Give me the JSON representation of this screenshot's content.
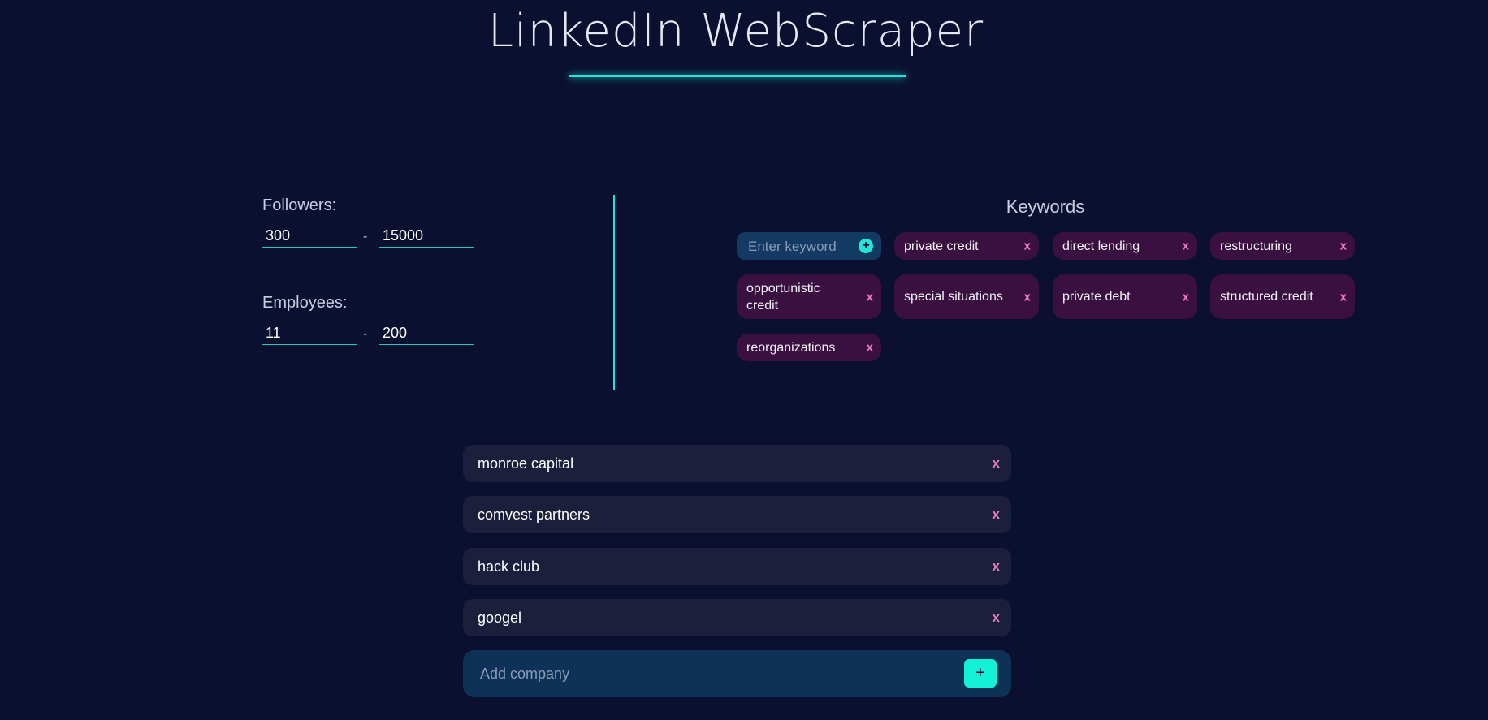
{
  "header": {
    "title": "LinkedIn WebScraper"
  },
  "filters": {
    "followers": {
      "label": "Followers:",
      "min": "300",
      "max": "15000",
      "separator": "-"
    },
    "employees": {
      "label": "Employees:",
      "min": "11",
      "max": "200",
      "separator": "-"
    }
  },
  "keywords": {
    "title": "Keywords",
    "input_placeholder": "Enter keyword",
    "add_icon": "+",
    "remove_label": "x",
    "items": [
      {
        "label": "private credit"
      },
      {
        "label": "direct lending"
      },
      {
        "label": "restructuring"
      },
      {
        "label": "opportunistic credit"
      },
      {
        "label": "special situations"
      },
      {
        "label": "private debt"
      },
      {
        "label": "structured credit"
      },
      {
        "label": "reorganizations"
      }
    ]
  },
  "companies": {
    "remove_label": "x",
    "items": [
      {
        "name": "monroe capital"
      },
      {
        "name": "comvest partners"
      },
      {
        "name": "hack club"
      },
      {
        "name": "googel"
      }
    ],
    "add_placeholder": "Add company",
    "add_button_label": "+"
  },
  "colors": {
    "background": "#0b1030",
    "accent": "#1fe6d8",
    "chip_bg": "#3a1040",
    "remove_x": "#f27ac6",
    "company_bg": "#1b1f3b",
    "input_bg": "#0e3257"
  }
}
